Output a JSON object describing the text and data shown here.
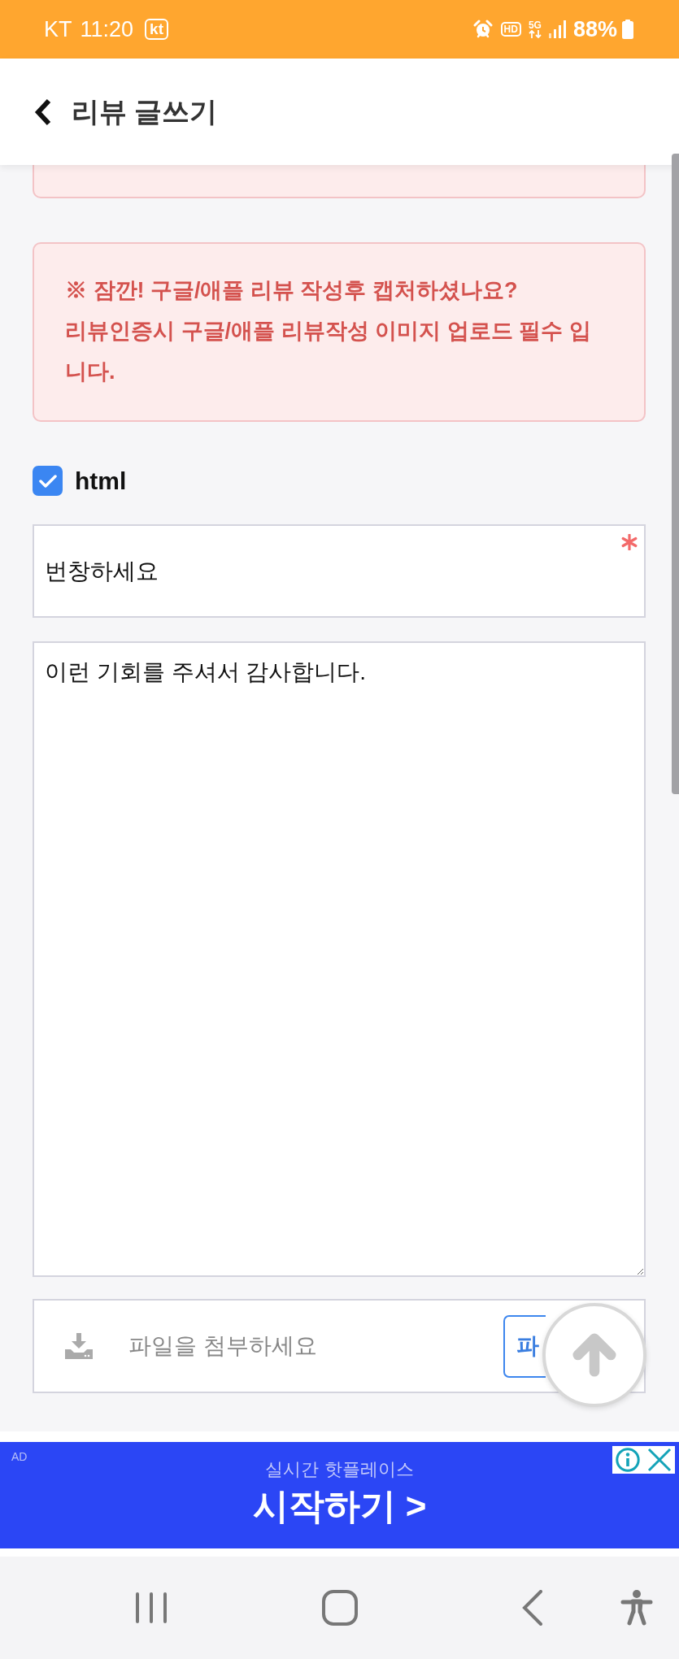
{
  "status_bar": {
    "carrier": "KT",
    "time": "11:20",
    "carrier_badge": "kt",
    "hd_label": "HD",
    "network_label": "5G",
    "battery": "88%"
  },
  "header": {
    "title": "리뷰 글쓰기"
  },
  "notices": [
    {
      "kind": "clipped"
    },
    {
      "kind": "full",
      "text": "※ 잠깐! 구글/애플 리뷰 작성후 캡처하셨나요?\n리뷰인증시 구글/애플 리뷰작성 이미지 업로드 필수 입니다."
    }
  ],
  "html_option": {
    "label": "html",
    "checked": true
  },
  "title_field": {
    "value": "번창하세요",
    "required": true
  },
  "content_field": {
    "value": "이런 기회를 주셔서 감사합니다."
  },
  "file_attach": {
    "placeholder": "파일을 첨부하세요",
    "button": "파"
  },
  "ad_banner": {
    "tag": "AD",
    "subtitle": "실시간 핫플레이스",
    "cta": "시작하기 >"
  }
}
